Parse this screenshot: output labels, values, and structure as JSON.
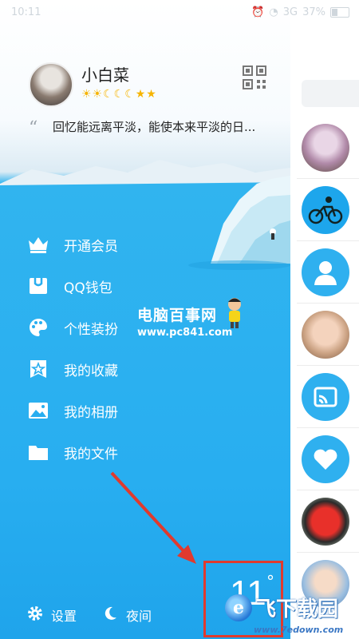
{
  "status_bar": {
    "time": "10:11",
    "network": "3G",
    "battery": "37%"
  },
  "profile": {
    "name": "小白菜",
    "level_icons": [
      "sun-icon",
      "sun-icon",
      "moon-icon",
      "moon-icon",
      "moon-icon",
      "star-icon",
      "star-icon"
    ],
    "signature": "回忆能远离平淡，能使本来平淡的日..."
  },
  "menu": {
    "items": [
      {
        "label": "开通会员",
        "icon": "crown-icon"
      },
      {
        "label": "QQ钱包",
        "icon": "wallet-icon"
      },
      {
        "label": "个性装扮",
        "icon": "palette-icon"
      },
      {
        "label": "我的收藏",
        "icon": "favorite-star-icon"
      },
      {
        "label": "我的相册",
        "icon": "photo-icon"
      },
      {
        "label": "我的文件",
        "icon": "folder-icon"
      }
    ]
  },
  "watermark": {
    "title": "电脑百事网",
    "url": "www.pc841.com"
  },
  "footer": {
    "settings_label": "设置",
    "night_label": "夜间"
  },
  "weather": {
    "temperature": "11",
    "unit": "°"
  },
  "bottom_watermark": {
    "text": "飞下载园",
    "url": "www.7edown.com"
  },
  "colors": {
    "menu_bg": "#28aef0",
    "highlight": "#e03a2e",
    "level_gold": "#f6b400"
  }
}
